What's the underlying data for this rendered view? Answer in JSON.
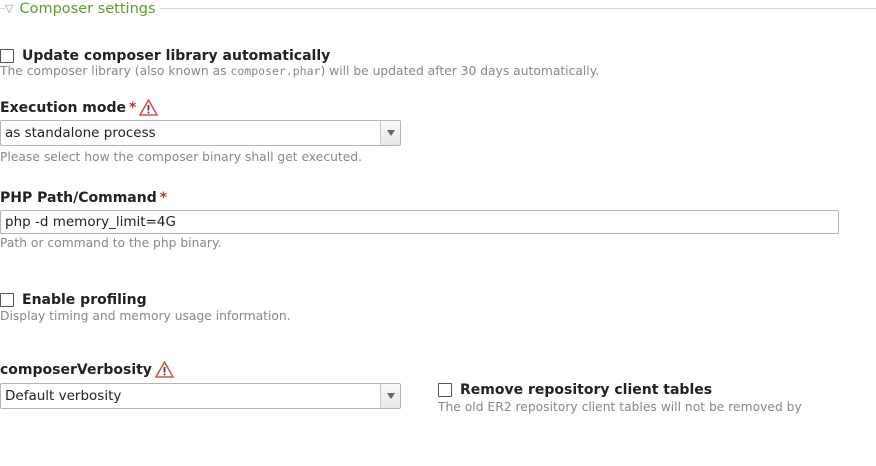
{
  "section": {
    "title": "Composer settings"
  },
  "update_library": {
    "label": "Update composer library automatically",
    "checked": false,
    "desc_before": "The composer library (also known as ",
    "desc_code": "composer.phar",
    "desc_after": ") will be updated after 30 days automatically."
  },
  "execution_mode": {
    "label": "Execution mode",
    "required_marker": "*",
    "selected": "as standalone process",
    "desc": "Please select how the composer binary shall get executed."
  },
  "php_path": {
    "label": "PHP Path/Command",
    "required_marker": "*",
    "value": "php -d memory_limit=4G",
    "desc": "Path or command to the php binary."
  },
  "profiling": {
    "label": "Enable profiling",
    "checked": false,
    "desc": "Display timing and memory usage information."
  },
  "verbosity": {
    "label": "composerVerbosity",
    "selected": "Default verbosity"
  },
  "remove_tables": {
    "label": "Remove repository client tables",
    "checked": false,
    "desc": "The old ER2 repository client tables will not be removed by"
  },
  "icons": {
    "warning": "warning-triangle-icon",
    "collapse": "collapse-triangle-icon",
    "dropdown": "chevron-down-icon"
  },
  "colors": {
    "legend": "#5aa02c",
    "required": "#c0392b",
    "warning": "#d9534f",
    "description": "#888888"
  }
}
